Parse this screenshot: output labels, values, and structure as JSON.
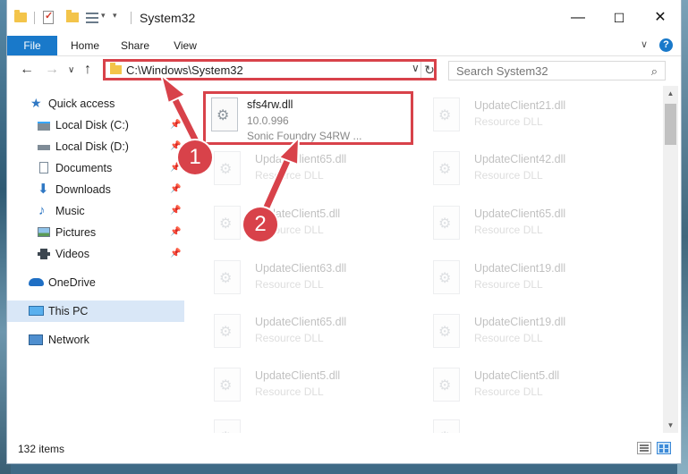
{
  "window": {
    "title": "System32",
    "controls": {
      "minimize": "—",
      "maximize": "☐",
      "close": "✕"
    }
  },
  "ribbon": {
    "tabs": [
      {
        "label": "File",
        "active": true
      },
      {
        "label": "Home"
      },
      {
        "label": "Share"
      },
      {
        "label": "View"
      }
    ],
    "help": "?"
  },
  "nav": {
    "address": "C:\\Windows\\System32",
    "search_placeholder": "Search System32"
  },
  "sidebar": {
    "items": [
      {
        "label": "Quick access",
        "icon": "star-icon"
      },
      {
        "label": "Local Disk (C:)",
        "icon": "drive-icon",
        "pinned": true
      },
      {
        "label": "Local Disk (D:)",
        "icon": "drive-icon",
        "pinned": true
      },
      {
        "label": "Documents",
        "icon": "documents-icon",
        "pinned": true
      },
      {
        "label": "Downloads",
        "icon": "downloads-icon",
        "pinned": true
      },
      {
        "label": "Music",
        "icon": "music-icon",
        "pinned": true
      },
      {
        "label": "Pictures",
        "icon": "pictures-icon",
        "pinned": true
      },
      {
        "label": "Videos",
        "icon": "videos-icon",
        "pinned": true
      },
      {
        "label": "OneDrive",
        "icon": "cloud-icon"
      },
      {
        "label": "This PC",
        "icon": "computer-icon",
        "selected": true
      },
      {
        "label": "Network",
        "icon": "network-icon"
      }
    ]
  },
  "files": [
    {
      "name": "sfs4rw.dll",
      "line1": "10.0.996",
      "line2": "Sonic Foundry S4RW ...",
      "highlighted": true
    },
    {
      "name": "UpdateClient21.dll",
      "line1": "Resource DLL"
    },
    {
      "name": "UpdateClient65.dll",
      "line1": "Resource DLL"
    },
    {
      "name": "UpdateClient42.dll",
      "line1": "Resource DLL"
    },
    {
      "name": "UpdateClient5.dll",
      "line1": "Resource DLL"
    },
    {
      "name": "UpdateClient65.dll",
      "line1": "Resource DLL"
    },
    {
      "name": "UpdateClient63.dll",
      "line1": "Resource DLL"
    },
    {
      "name": "UpdateClient19.dll",
      "line1": "Resource DLL"
    },
    {
      "name": "UpdateClient65.dll",
      "line1": "Resource DLL"
    },
    {
      "name": "UpdateClient19.dll",
      "line1": "Resource DLL"
    },
    {
      "name": "UpdateClient5.dll",
      "line1": "Resource DLL"
    },
    {
      "name": "UpdateClient5.dll",
      "line1": "Resource DLL"
    }
  ],
  "status": {
    "item_count": "132 items"
  },
  "annotations": {
    "badge1": "1",
    "badge2": "2",
    "color": "#d8424a"
  }
}
